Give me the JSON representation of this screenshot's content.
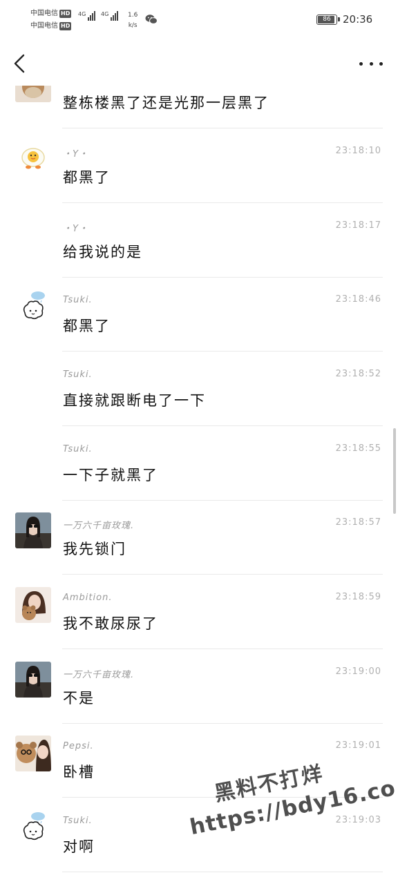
{
  "status_bar": {
    "carrier1": "中国电信",
    "carrier2": "中国电信",
    "hd": "HD",
    "net1": "4G",
    "net2": "4G",
    "speed_value": "1.6",
    "speed_unit": "k/s",
    "battery": "86",
    "time": "20:36"
  },
  "nav": {
    "back_icon": "chevron-left-icon",
    "more_icon": "more-dots-icon"
  },
  "messages": [
    {
      "name": "",
      "time": "",
      "text": "整栋楼黑了还是光那一层黑了",
      "avatar": "teddy-bear-photo"
    },
    {
      "name": "・Y・",
      "time": "23:18:10",
      "text": "都黑了",
      "avatar": "egg-duck-cartoon"
    },
    {
      "name": "・Y・",
      "time": "23:18:17",
      "text": "给我说的是",
      "avatar": ""
    },
    {
      "name": "Tsuki.",
      "time": "23:18:46",
      "text": "都黑了",
      "avatar": "cloud-bear-cartoon"
    },
    {
      "name": "Tsuki.",
      "time": "23:18:52",
      "text": "直接就跟断电了一下",
      "avatar": ""
    },
    {
      "name": "Tsuki.",
      "time": "23:18:55",
      "text": "一下子就黑了",
      "avatar": ""
    },
    {
      "name": "一万六千亩玫瑰.",
      "time": "23:18:57",
      "text": "我先锁门",
      "avatar": "girl-sunglasses-photo"
    },
    {
      "name": "Ambition.",
      "time": "23:18:59",
      "text": "我不敢尿尿了",
      "avatar": "girl-with-bear-photo"
    },
    {
      "name": "一万六千亩玫瑰.",
      "time": "23:19:00",
      "text": "不是",
      "avatar": "girl-sunglasses-photo"
    },
    {
      "name": "Pepsi.",
      "time": "23:19:01",
      "text": "卧槽",
      "avatar": "girl-and-bear-photo"
    },
    {
      "name": "Tsuki.",
      "time": "23:19:03",
      "text": "对啊",
      "avatar": "cloud-bear-cartoon"
    }
  ],
  "watermark": {
    "line1": "黑料不打烊",
    "line2": "https://bdy16.co"
  },
  "colors": {
    "separator": "#e9e9e9",
    "meta_text": "#9a9a9a",
    "message_text": "#111111"
  }
}
